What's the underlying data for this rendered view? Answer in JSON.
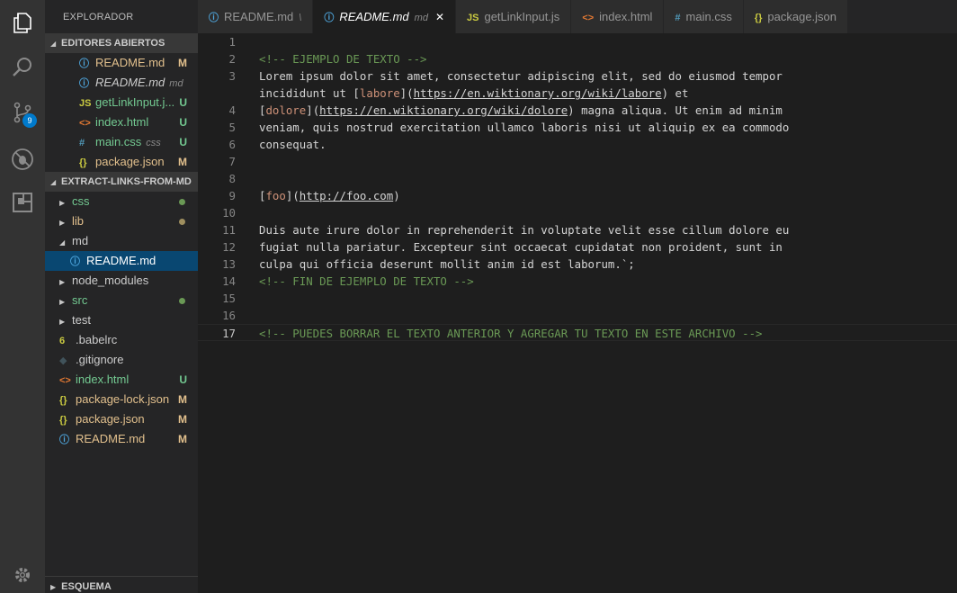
{
  "activity_bar": {
    "icons": [
      "explorer-icon",
      "search-icon",
      "source-control-icon",
      "debug-icon",
      "extensions-icon",
      "settings-gear-icon"
    ],
    "scm_badge": "9"
  },
  "sidebar": {
    "title": "EXPLORADOR",
    "open_editors": {
      "header": "EDITORES ABIERTOS",
      "items": [
        {
          "icon": "ⓘ",
          "icon_color": "#4fa8e0",
          "name": "README.md",
          "suffix": "M",
          "color": "#e2c08d"
        },
        {
          "icon": "ⓘ",
          "icon_color": "#4fa8e0",
          "name": "README.md",
          "extra": "md",
          "color": "#cccccc",
          "italic": true
        },
        {
          "icon": "JS",
          "icon_color": "#cbcb41",
          "name": "getLinkInput.j...",
          "suffix": "U",
          "color": "#73c991"
        },
        {
          "icon": "<>",
          "icon_color": "#e37933",
          "name": "index.html",
          "suffix": "U",
          "color": "#73c991"
        },
        {
          "icon": "#",
          "icon_color": "#519aba",
          "name": "main.css",
          "extra": "css",
          "suffix": "U",
          "color": "#73c991"
        },
        {
          "icon": "{}",
          "icon_color": "#cbcb41",
          "name": "package.json",
          "suffix": "M",
          "color": "#e2c08d"
        }
      ]
    },
    "project": {
      "header": "EXTRACT-LINKS-FROM-MD",
      "items": [
        {
          "type": "folder",
          "name": "css",
          "color": "#73c991",
          "dot": "#6a9955"
        },
        {
          "type": "folder",
          "name": "lib",
          "color": "#e2c08d",
          "dot": "#9f8f5f"
        },
        {
          "type": "folder-open",
          "name": "md",
          "color": "#cccccc"
        },
        {
          "type": "file",
          "icon": "ⓘ",
          "icon_color": "#4fa8e0",
          "name": "README.md",
          "color": "#ffffff",
          "selected": true,
          "indent": 2
        },
        {
          "type": "folder",
          "name": "node_modules",
          "color": "#cccccc"
        },
        {
          "type": "folder",
          "name": "src",
          "color": "#73c991",
          "dot": "#6a9955"
        },
        {
          "type": "folder",
          "name": "test",
          "color": "#cccccc"
        },
        {
          "type": "file",
          "icon": "6",
          "icon_color": "#cbcb41",
          "name": ".babelrc",
          "color": "#cccccc"
        },
        {
          "type": "file",
          "icon": "◆",
          "icon_color": "#41535b",
          "name": ".gitignore",
          "color": "#cccccc"
        },
        {
          "type": "file",
          "icon": "<>",
          "icon_color": "#e37933",
          "name": "index.html",
          "suffix": "U",
          "color": "#73c991"
        },
        {
          "type": "file",
          "icon": "{}",
          "icon_color": "#cbcb41",
          "name": "package-lock.json",
          "suffix": "M",
          "color": "#e2c08d"
        },
        {
          "type": "file",
          "icon": "{}",
          "icon_color": "#cbcb41",
          "name": "package.json",
          "suffix": "M",
          "color": "#e2c08d"
        },
        {
          "type": "file",
          "icon": "ⓘ",
          "icon_color": "#4fa8e0",
          "name": "README.md",
          "suffix": "M",
          "color": "#e2c08d"
        }
      ]
    },
    "outline_header": "ESQUEMA"
  },
  "tabs": [
    {
      "icon": "ⓘ",
      "icon_color": "#4fa8e0",
      "label": "README.md",
      "extra": "\\",
      "active": false
    },
    {
      "icon": "ⓘ",
      "icon_color": "#4fa8e0",
      "label": "README.md",
      "sub": "md",
      "active": true,
      "italic": true,
      "close": "✕"
    },
    {
      "icon": "JS",
      "icon_color": "#cbcb41",
      "label": "getLinkInput.js",
      "active": false
    },
    {
      "icon": "<>",
      "icon_color": "#e37933",
      "label": "index.html",
      "active": false
    },
    {
      "icon": "#",
      "icon_color": "#519aba",
      "label": "main.css",
      "active": false
    },
    {
      "icon": "{}",
      "icon_color": "#cbcb41",
      "label": "package.json",
      "active": false
    }
  ],
  "editor": {
    "current_line": 17,
    "lines": [
      {
        "n": "1",
        "parts": []
      },
      {
        "n": "2",
        "parts": [
          {
            "t": "<!-- EJEMPLO DE TEXTO -->",
            "c": "cm"
          }
        ]
      },
      {
        "n": "3",
        "parts": [
          {
            "t": "Lorem ipsum dolor sit amet, consectetur adipiscing elit, sed do eiusmod tempor"
          }
        ]
      },
      {
        "n": "",
        "parts": [
          {
            "t": "incididunt ut ["
          },
          {
            "t": "labore",
            "c": "lk"
          },
          {
            "t": "]("
          },
          {
            "t": "https://en.wiktionary.org/wiki/labore",
            "c": "url"
          },
          {
            "t": ") et"
          }
        ]
      },
      {
        "n": "4",
        "parts": [
          {
            "t": "["
          },
          {
            "t": "dolore",
            "c": "lk"
          },
          {
            "t": "]("
          },
          {
            "t": "https://en.wiktionary.org/wiki/dolore",
            "c": "url"
          },
          {
            "t": ") magna aliqua. Ut enim ad minim"
          }
        ]
      },
      {
        "n": "5",
        "parts": [
          {
            "t": "veniam, quis nostrud exercitation ullamco laboris nisi ut aliquip ex ea commodo"
          }
        ]
      },
      {
        "n": "6",
        "parts": [
          {
            "t": "consequat."
          }
        ]
      },
      {
        "n": "7",
        "parts": []
      },
      {
        "n": "8",
        "parts": []
      },
      {
        "n": "9",
        "parts": [
          {
            "t": "["
          },
          {
            "t": "foo",
            "c": "lk"
          },
          {
            "t": "]("
          },
          {
            "t": "http://foo.com",
            "c": "url"
          },
          {
            "t": ")"
          }
        ]
      },
      {
        "n": "10",
        "parts": []
      },
      {
        "n": "11",
        "parts": [
          {
            "t": "Duis aute irure dolor in reprehenderit in voluptate velit esse cillum dolore eu"
          }
        ]
      },
      {
        "n": "12",
        "parts": [
          {
            "t": "fugiat nulla pariatur. Excepteur sint occaecat cupidatat non proident, sunt in"
          }
        ]
      },
      {
        "n": "13",
        "parts": [
          {
            "t": "culpa qui officia deserunt mollit anim id est laborum.`;"
          }
        ]
      },
      {
        "n": "14",
        "parts": [
          {
            "t": "<!-- FIN DE EJEMPLO DE TEXTO -->",
            "c": "cm"
          }
        ]
      },
      {
        "n": "15",
        "parts": []
      },
      {
        "n": "16",
        "parts": []
      },
      {
        "n": "17",
        "parts": [
          {
            "t": "<!-- PUEDES BORRAR EL TEXTO ANTERIOR Y AGREGAR TU TEXTO EN ESTE ARCHIVO -->",
            "c": "cm"
          }
        ]
      }
    ]
  }
}
